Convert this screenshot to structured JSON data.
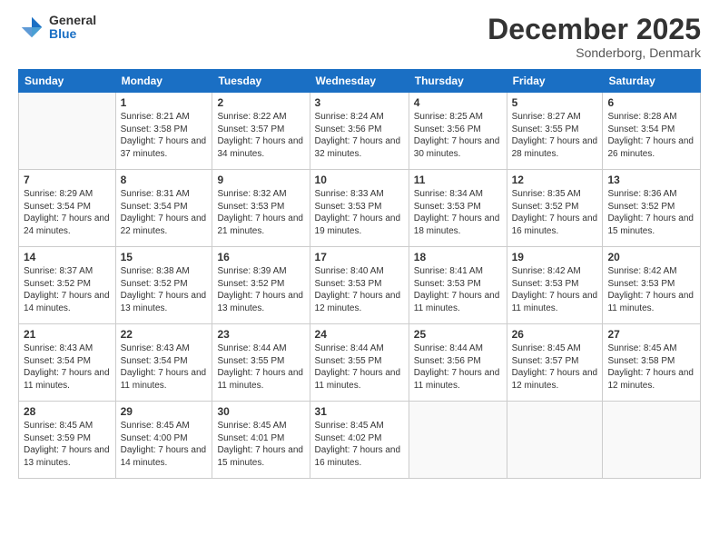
{
  "logo": {
    "general": "General",
    "blue": "Blue"
  },
  "header": {
    "month_year": "December 2025",
    "location": "Sonderborg, Denmark"
  },
  "weekdays": [
    "Sunday",
    "Monday",
    "Tuesday",
    "Wednesday",
    "Thursday",
    "Friday",
    "Saturday"
  ],
  "weeks": [
    [
      {
        "num": "",
        "sunrise": "",
        "sunset": "",
        "daylight": ""
      },
      {
        "num": "1",
        "sunrise": "Sunrise: 8:21 AM",
        "sunset": "Sunset: 3:58 PM",
        "daylight": "Daylight: 7 hours and 37 minutes."
      },
      {
        "num": "2",
        "sunrise": "Sunrise: 8:22 AM",
        "sunset": "Sunset: 3:57 PM",
        "daylight": "Daylight: 7 hours and 34 minutes."
      },
      {
        "num": "3",
        "sunrise": "Sunrise: 8:24 AM",
        "sunset": "Sunset: 3:56 PM",
        "daylight": "Daylight: 7 hours and 32 minutes."
      },
      {
        "num": "4",
        "sunrise": "Sunrise: 8:25 AM",
        "sunset": "Sunset: 3:56 PM",
        "daylight": "Daylight: 7 hours and 30 minutes."
      },
      {
        "num": "5",
        "sunrise": "Sunrise: 8:27 AM",
        "sunset": "Sunset: 3:55 PM",
        "daylight": "Daylight: 7 hours and 28 minutes."
      },
      {
        "num": "6",
        "sunrise": "Sunrise: 8:28 AM",
        "sunset": "Sunset: 3:54 PM",
        "daylight": "Daylight: 7 hours and 26 minutes."
      }
    ],
    [
      {
        "num": "7",
        "sunrise": "Sunrise: 8:29 AM",
        "sunset": "Sunset: 3:54 PM",
        "daylight": "Daylight: 7 hours and 24 minutes."
      },
      {
        "num": "8",
        "sunrise": "Sunrise: 8:31 AM",
        "sunset": "Sunset: 3:54 PM",
        "daylight": "Daylight: 7 hours and 22 minutes."
      },
      {
        "num": "9",
        "sunrise": "Sunrise: 8:32 AM",
        "sunset": "Sunset: 3:53 PM",
        "daylight": "Daylight: 7 hours and 21 minutes."
      },
      {
        "num": "10",
        "sunrise": "Sunrise: 8:33 AM",
        "sunset": "Sunset: 3:53 PM",
        "daylight": "Daylight: 7 hours and 19 minutes."
      },
      {
        "num": "11",
        "sunrise": "Sunrise: 8:34 AM",
        "sunset": "Sunset: 3:53 PM",
        "daylight": "Daylight: 7 hours and 18 minutes."
      },
      {
        "num": "12",
        "sunrise": "Sunrise: 8:35 AM",
        "sunset": "Sunset: 3:52 PM",
        "daylight": "Daylight: 7 hours and 16 minutes."
      },
      {
        "num": "13",
        "sunrise": "Sunrise: 8:36 AM",
        "sunset": "Sunset: 3:52 PM",
        "daylight": "Daylight: 7 hours and 15 minutes."
      }
    ],
    [
      {
        "num": "14",
        "sunrise": "Sunrise: 8:37 AM",
        "sunset": "Sunset: 3:52 PM",
        "daylight": "Daylight: 7 hours and 14 minutes."
      },
      {
        "num": "15",
        "sunrise": "Sunrise: 8:38 AM",
        "sunset": "Sunset: 3:52 PM",
        "daylight": "Daylight: 7 hours and 13 minutes."
      },
      {
        "num": "16",
        "sunrise": "Sunrise: 8:39 AM",
        "sunset": "Sunset: 3:52 PM",
        "daylight": "Daylight: 7 hours and 13 minutes."
      },
      {
        "num": "17",
        "sunrise": "Sunrise: 8:40 AM",
        "sunset": "Sunset: 3:53 PM",
        "daylight": "Daylight: 7 hours and 12 minutes."
      },
      {
        "num": "18",
        "sunrise": "Sunrise: 8:41 AM",
        "sunset": "Sunset: 3:53 PM",
        "daylight": "Daylight: 7 hours and 11 minutes."
      },
      {
        "num": "19",
        "sunrise": "Sunrise: 8:42 AM",
        "sunset": "Sunset: 3:53 PM",
        "daylight": "Daylight: 7 hours and 11 minutes."
      },
      {
        "num": "20",
        "sunrise": "Sunrise: 8:42 AM",
        "sunset": "Sunset: 3:53 PM",
        "daylight": "Daylight: 7 hours and 11 minutes."
      }
    ],
    [
      {
        "num": "21",
        "sunrise": "Sunrise: 8:43 AM",
        "sunset": "Sunset: 3:54 PM",
        "daylight": "Daylight: 7 hours and 11 minutes."
      },
      {
        "num": "22",
        "sunrise": "Sunrise: 8:43 AM",
        "sunset": "Sunset: 3:54 PM",
        "daylight": "Daylight: 7 hours and 11 minutes."
      },
      {
        "num": "23",
        "sunrise": "Sunrise: 8:44 AM",
        "sunset": "Sunset: 3:55 PM",
        "daylight": "Daylight: 7 hours and 11 minutes."
      },
      {
        "num": "24",
        "sunrise": "Sunrise: 8:44 AM",
        "sunset": "Sunset: 3:55 PM",
        "daylight": "Daylight: 7 hours and 11 minutes."
      },
      {
        "num": "25",
        "sunrise": "Sunrise: 8:44 AM",
        "sunset": "Sunset: 3:56 PM",
        "daylight": "Daylight: 7 hours and 11 minutes."
      },
      {
        "num": "26",
        "sunrise": "Sunrise: 8:45 AM",
        "sunset": "Sunset: 3:57 PM",
        "daylight": "Daylight: 7 hours and 12 minutes."
      },
      {
        "num": "27",
        "sunrise": "Sunrise: 8:45 AM",
        "sunset": "Sunset: 3:58 PM",
        "daylight": "Daylight: 7 hours and 12 minutes."
      }
    ],
    [
      {
        "num": "28",
        "sunrise": "Sunrise: 8:45 AM",
        "sunset": "Sunset: 3:59 PM",
        "daylight": "Daylight: 7 hours and 13 minutes."
      },
      {
        "num": "29",
        "sunrise": "Sunrise: 8:45 AM",
        "sunset": "Sunset: 4:00 PM",
        "daylight": "Daylight: 7 hours and 14 minutes."
      },
      {
        "num": "30",
        "sunrise": "Sunrise: 8:45 AM",
        "sunset": "Sunset: 4:01 PM",
        "daylight": "Daylight: 7 hours and 15 minutes."
      },
      {
        "num": "31",
        "sunrise": "Sunrise: 8:45 AM",
        "sunset": "Sunset: 4:02 PM",
        "daylight": "Daylight: 7 hours and 16 minutes."
      },
      {
        "num": "",
        "sunrise": "",
        "sunset": "",
        "daylight": ""
      },
      {
        "num": "",
        "sunrise": "",
        "sunset": "",
        "daylight": ""
      },
      {
        "num": "",
        "sunrise": "",
        "sunset": "",
        "daylight": ""
      }
    ]
  ]
}
